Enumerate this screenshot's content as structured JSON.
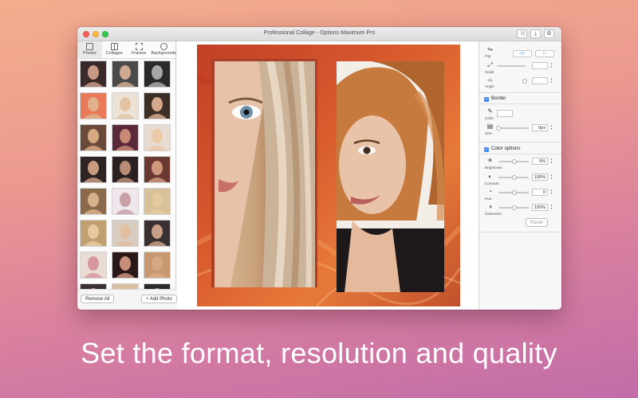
{
  "window": {
    "title": "Professional Collage - Options Maximum Pro",
    "toolbar_icons": [
      "shuffle-icon",
      "download-icon",
      "gear-icon"
    ]
  },
  "left_panel": {
    "tabs": [
      {
        "label": "Photos",
        "icon": "photos-icon",
        "active": true
      },
      {
        "label": "Collages",
        "icon": "collages-icon",
        "active": false
      },
      {
        "label": "Frames",
        "icon": "frames-icon",
        "active": false
      },
      {
        "label": "Backgrounds",
        "icon": "backgrounds-icon",
        "active": false
      }
    ],
    "thumbnails": [
      {
        "bg": "#3a2a2a",
        "skin": "#c89a86"
      },
      {
        "bg": "#4a4a4a",
        "skin": "#d0a890"
      },
      {
        "bg": "#2a2a2a",
        "skin": "#a8a8a8"
      },
      {
        "bg": "#e87a5a",
        "skin": "#e0b08a"
      },
      {
        "bg": "#ede2d6",
        "skin": "#e2c4a4"
      },
      {
        "bg": "#3e2e26",
        "skin": "#d4a88c"
      },
      {
        "bg": "#6a4a3a",
        "skin": "#d8a882"
      },
      {
        "bg": "#5a2a3a",
        "skin": "#c88a74"
      },
      {
        "bg": "#e8dcd0",
        "skin": "#eac8a8"
      },
      {
        "bg": "#2e2222",
        "skin": "#c89a80"
      },
      {
        "bg": "#2a2020",
        "skin": "#b88c76"
      },
      {
        "bg": "#6a3a32",
        "skin": "#d0987c"
      },
      {
        "bg": "#8a6a4a",
        "skin": "#d8b08a"
      },
      {
        "bg": "#efe6ee",
        "skin": "#c8a0a8"
      },
      {
        "bg": "#d8c098",
        "skin": "#e4c8a0"
      },
      {
        "bg": "#c0a070",
        "skin": "#e8c8a0"
      },
      {
        "bg": "#d8ccc0",
        "skin": "#e0c0a0"
      },
      {
        "bg": "#3a3230",
        "skin": "#c8a088"
      },
      {
        "bg": "#e8dcd4",
        "skin": "#d898a0"
      },
      {
        "bg": "#2a1818",
        "skin": "#c8907c"
      },
      {
        "bg": "#c89870",
        "skin": "#d8a882"
      },
      {
        "bg": "#3a3030",
        "skin": "#c89a86"
      },
      {
        "bg": "#d8c0a0",
        "skin": "#e0b890"
      },
      {
        "bg": "#2a2a2a",
        "skin": "#b89080"
      }
    ],
    "remove_all_label": "Remove All",
    "add_photo_label": "+ Add Photo"
  },
  "right_panel": {
    "flip_label": "Flip",
    "scale_label": "Scale",
    "angle_label": "Angle",
    "border_label": "Border",
    "border_checked": true,
    "color_label": "Color",
    "size_label": "Size",
    "size_value": "0px",
    "color_options_label": "Color options",
    "color_options_checked": true,
    "brightness_label": "Brightness",
    "brightness_value": "0%",
    "contrast_label": "Contrast",
    "contrast_value": "100%",
    "hue_label": "Hue",
    "hue_value": "0",
    "saturation_label": "Saturation",
    "saturation_value": "100%",
    "reset_label": "Reset"
  },
  "collage": {
    "background_accent": "#d85a2d",
    "photos": [
      "portrait-left",
      "portrait-right"
    ]
  },
  "caption": "Set the format, resolution and quality"
}
